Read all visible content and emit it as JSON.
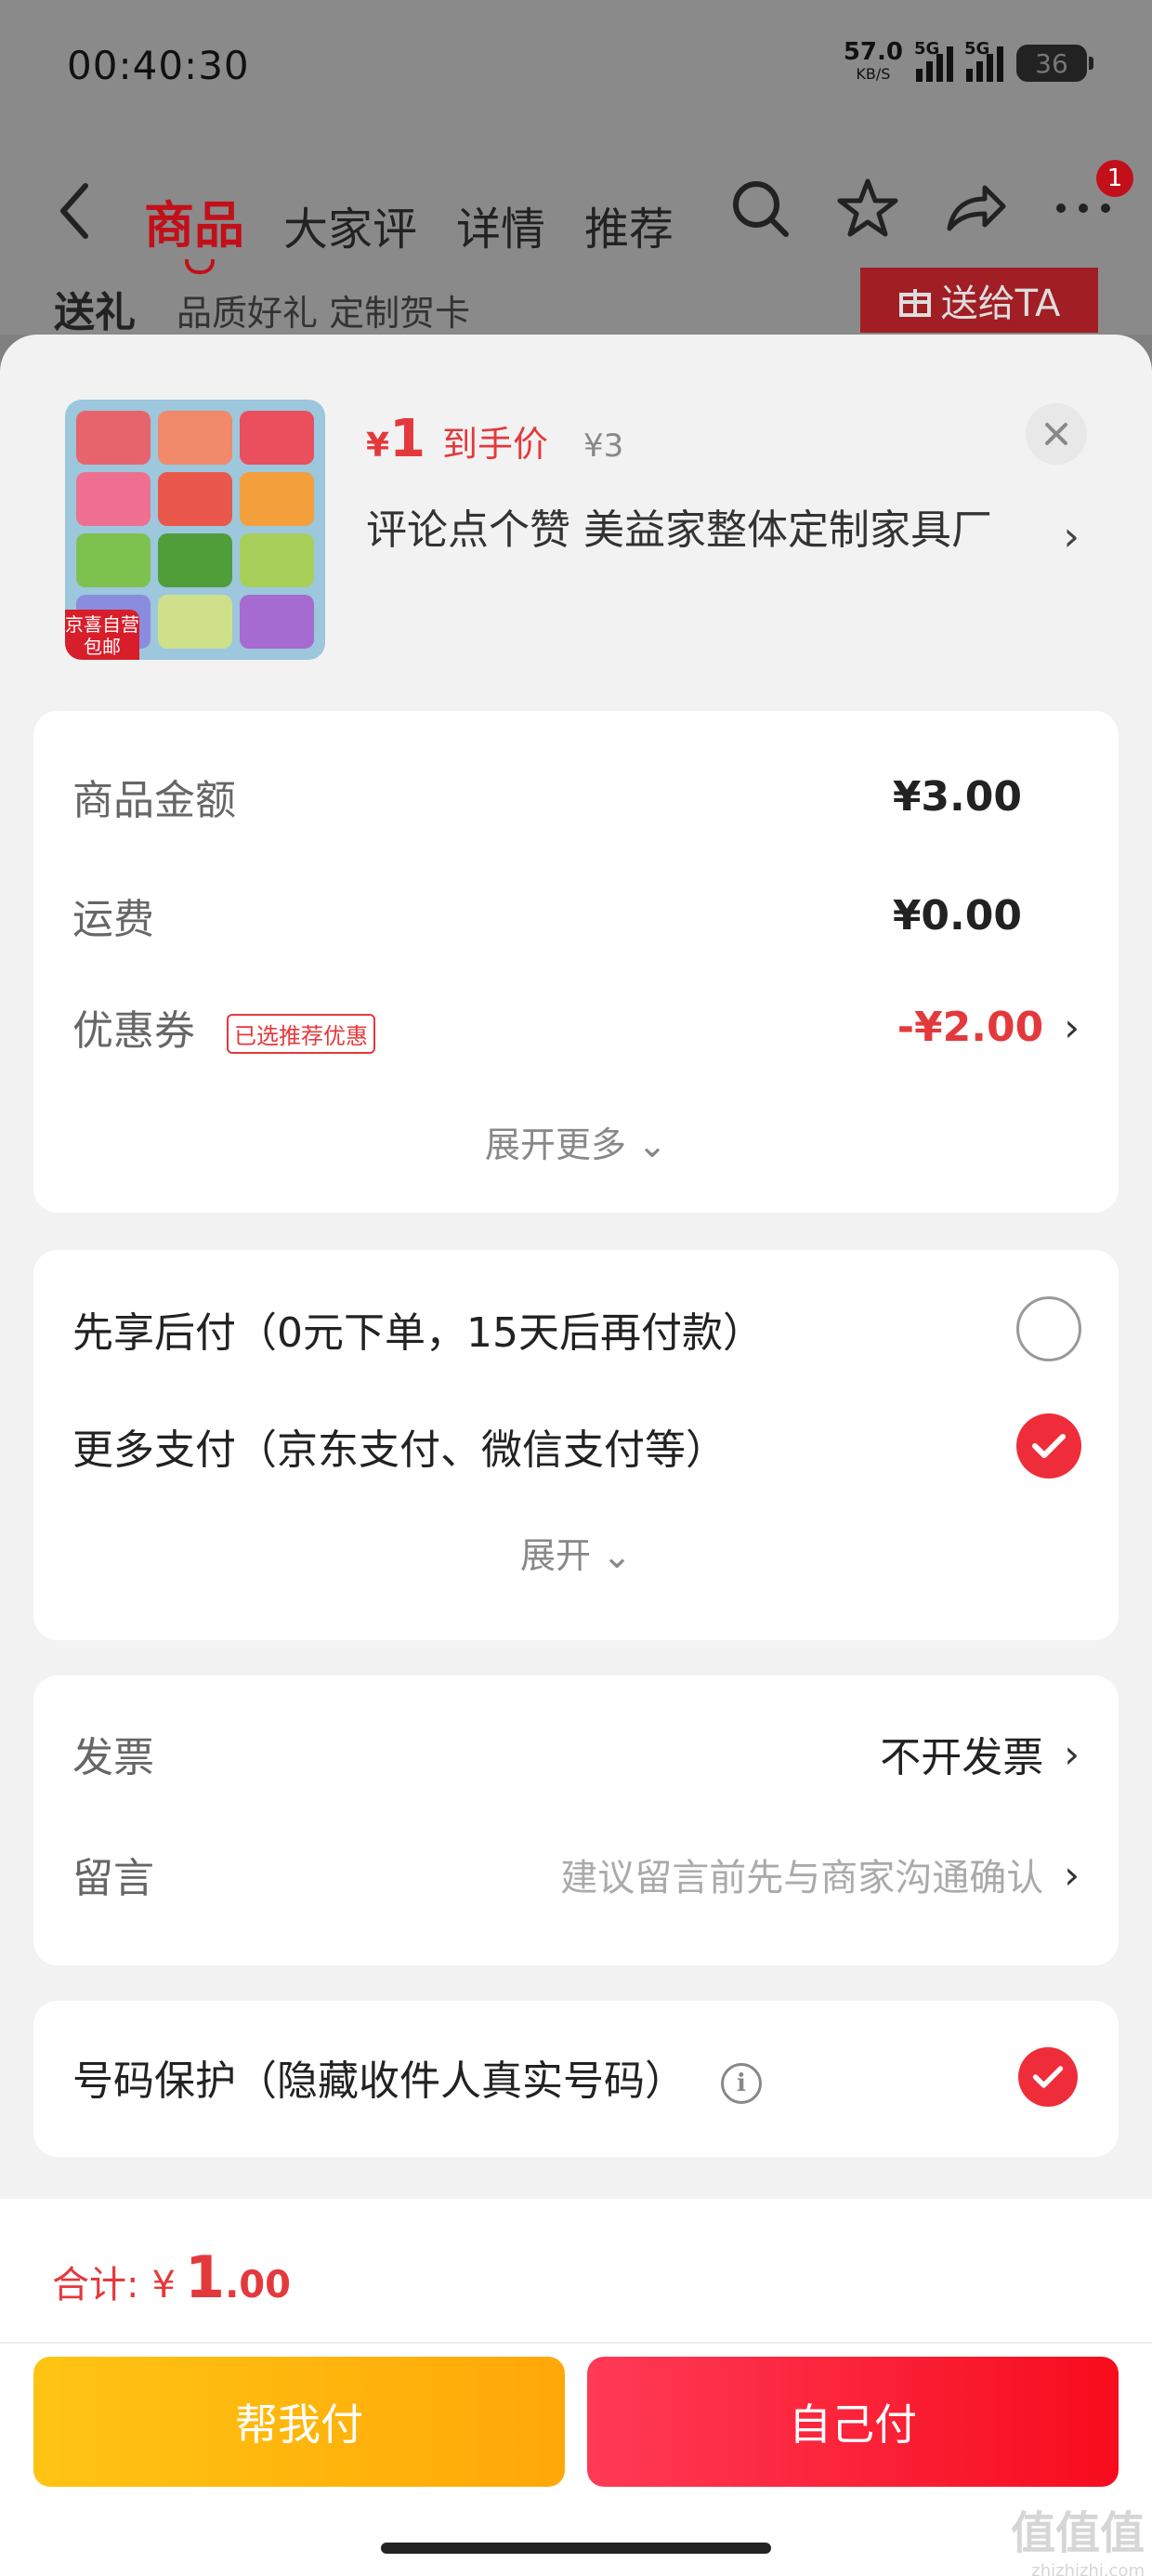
{
  "status_bar": {
    "time": "00:40:30",
    "net_speed": "57.0",
    "net_unit": "KB/S",
    "sig1_tag": "5G",
    "sig2_tag": "5G",
    "battery": "36"
  },
  "nav": {
    "back_icon": "chevron-left-icon",
    "tabs": [
      {
        "label": "商品",
        "active": true
      },
      {
        "label": "大家评"
      },
      {
        "label": "详情"
      },
      {
        "label": "推荐"
      }
    ],
    "badge": "1"
  },
  "background_page": {
    "title": "送礼",
    "subtitle": "品质好礼 定制贺卡",
    "button": "送给TA"
  },
  "product": {
    "price_symbol": "¥",
    "price": "1",
    "price_label": "到手价",
    "original_price": "¥3",
    "title": "评论点个赞  美益家整体定制家具厂",
    "thumb_badge_line1": "京喜自营",
    "thumb_badge_line2": "包邮"
  },
  "costs": {
    "goods_label": "商品金额",
    "goods_value": "¥3.00",
    "shipping_label": "运费",
    "shipping_value": "¥0.00",
    "coupon_label": "优惠券",
    "coupon_tag": "已选推荐优惠",
    "coupon_value": "-¥2.00",
    "expand_label": "展开更多"
  },
  "payment": {
    "option1": "先享后付（0元下单，15天后再付款）",
    "option2": "更多支付（京东支付、微信支付等）",
    "selected": 2,
    "expand_label": "展开"
  },
  "invoice": {
    "invoice_label": "发票",
    "invoice_value": "不开发票",
    "message_label": "留言",
    "message_placeholder": "建议留言前先与商家沟通确认"
  },
  "privacy": {
    "label": "号码保护（隐藏收件人真实号码）",
    "checked": true
  },
  "footer": {
    "total_label": "合计:",
    "total_symbol": "¥",
    "total_int": "1",
    "total_dec": ".00",
    "help_pay": "帮我付",
    "self_pay": "自己付"
  },
  "watermark": {
    "text": "值值值",
    "sub": "zhizhizhi.com"
  },
  "colors": {
    "accent": "#e4393c",
    "brand_red": "#c2101b",
    "help_btn": "#ffb20e",
    "self_btn": "#f7213a"
  }
}
